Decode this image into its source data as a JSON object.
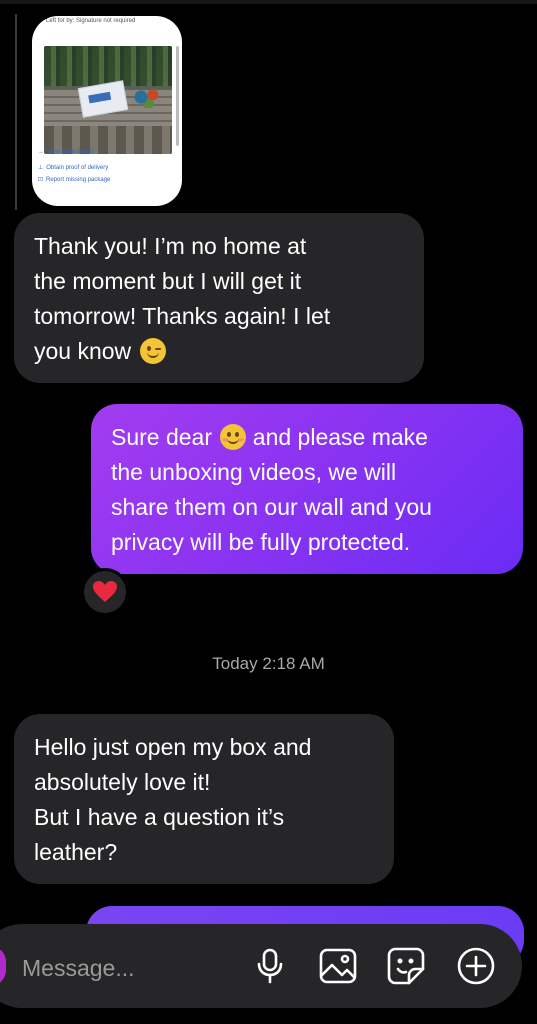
{
  "conversation": {
    "shared_card": {
      "caption": "Left for by: Signature not required",
      "links": [
        {
          "icon": "arrow-right-icon",
          "label": "View more details"
        },
        {
          "icon": "proof-icon",
          "label": "Obtain proof of delivery"
        },
        {
          "icon": "report-icon",
          "label": "Report missing package"
        }
      ]
    },
    "messages": [
      {
        "direction": "incoming",
        "lines": [
          "Thank you! I’m no home at",
          "the moment but I will get it",
          "tomorrow!  Thanks again! I let",
          "you know"
        ],
        "emoji": "winking-face-emoji"
      },
      {
        "direction": "outgoing",
        "lines_pre": "Sure dear",
        "emoji": "smiling-face-emoji",
        "lines_post": " and please make",
        "lines": [
          "the unboxing videos, we will",
          "share them on our wall and you",
          "privacy will be fully protected."
        ],
        "reaction": "red-heart"
      },
      {
        "direction": "incoming",
        "lines": [
          "Hello just open my box and",
          "absolutely love it!",
          "But I have a question it’s",
          "leather?"
        ]
      }
    ],
    "timestamp": "Today 2:18 AM"
  },
  "composer": {
    "placeholder": "Message...",
    "tools": [
      "microphone-icon",
      "gallery-icon",
      "sticker-icon",
      "add-icon"
    ]
  },
  "colors": {
    "background": "#000000",
    "incoming_bubble": "#262628",
    "outgoing_gradient_start": "#a23cf0",
    "outgoing_gradient_end": "#6a2cf4",
    "timestamp": "#a8a8a8"
  }
}
